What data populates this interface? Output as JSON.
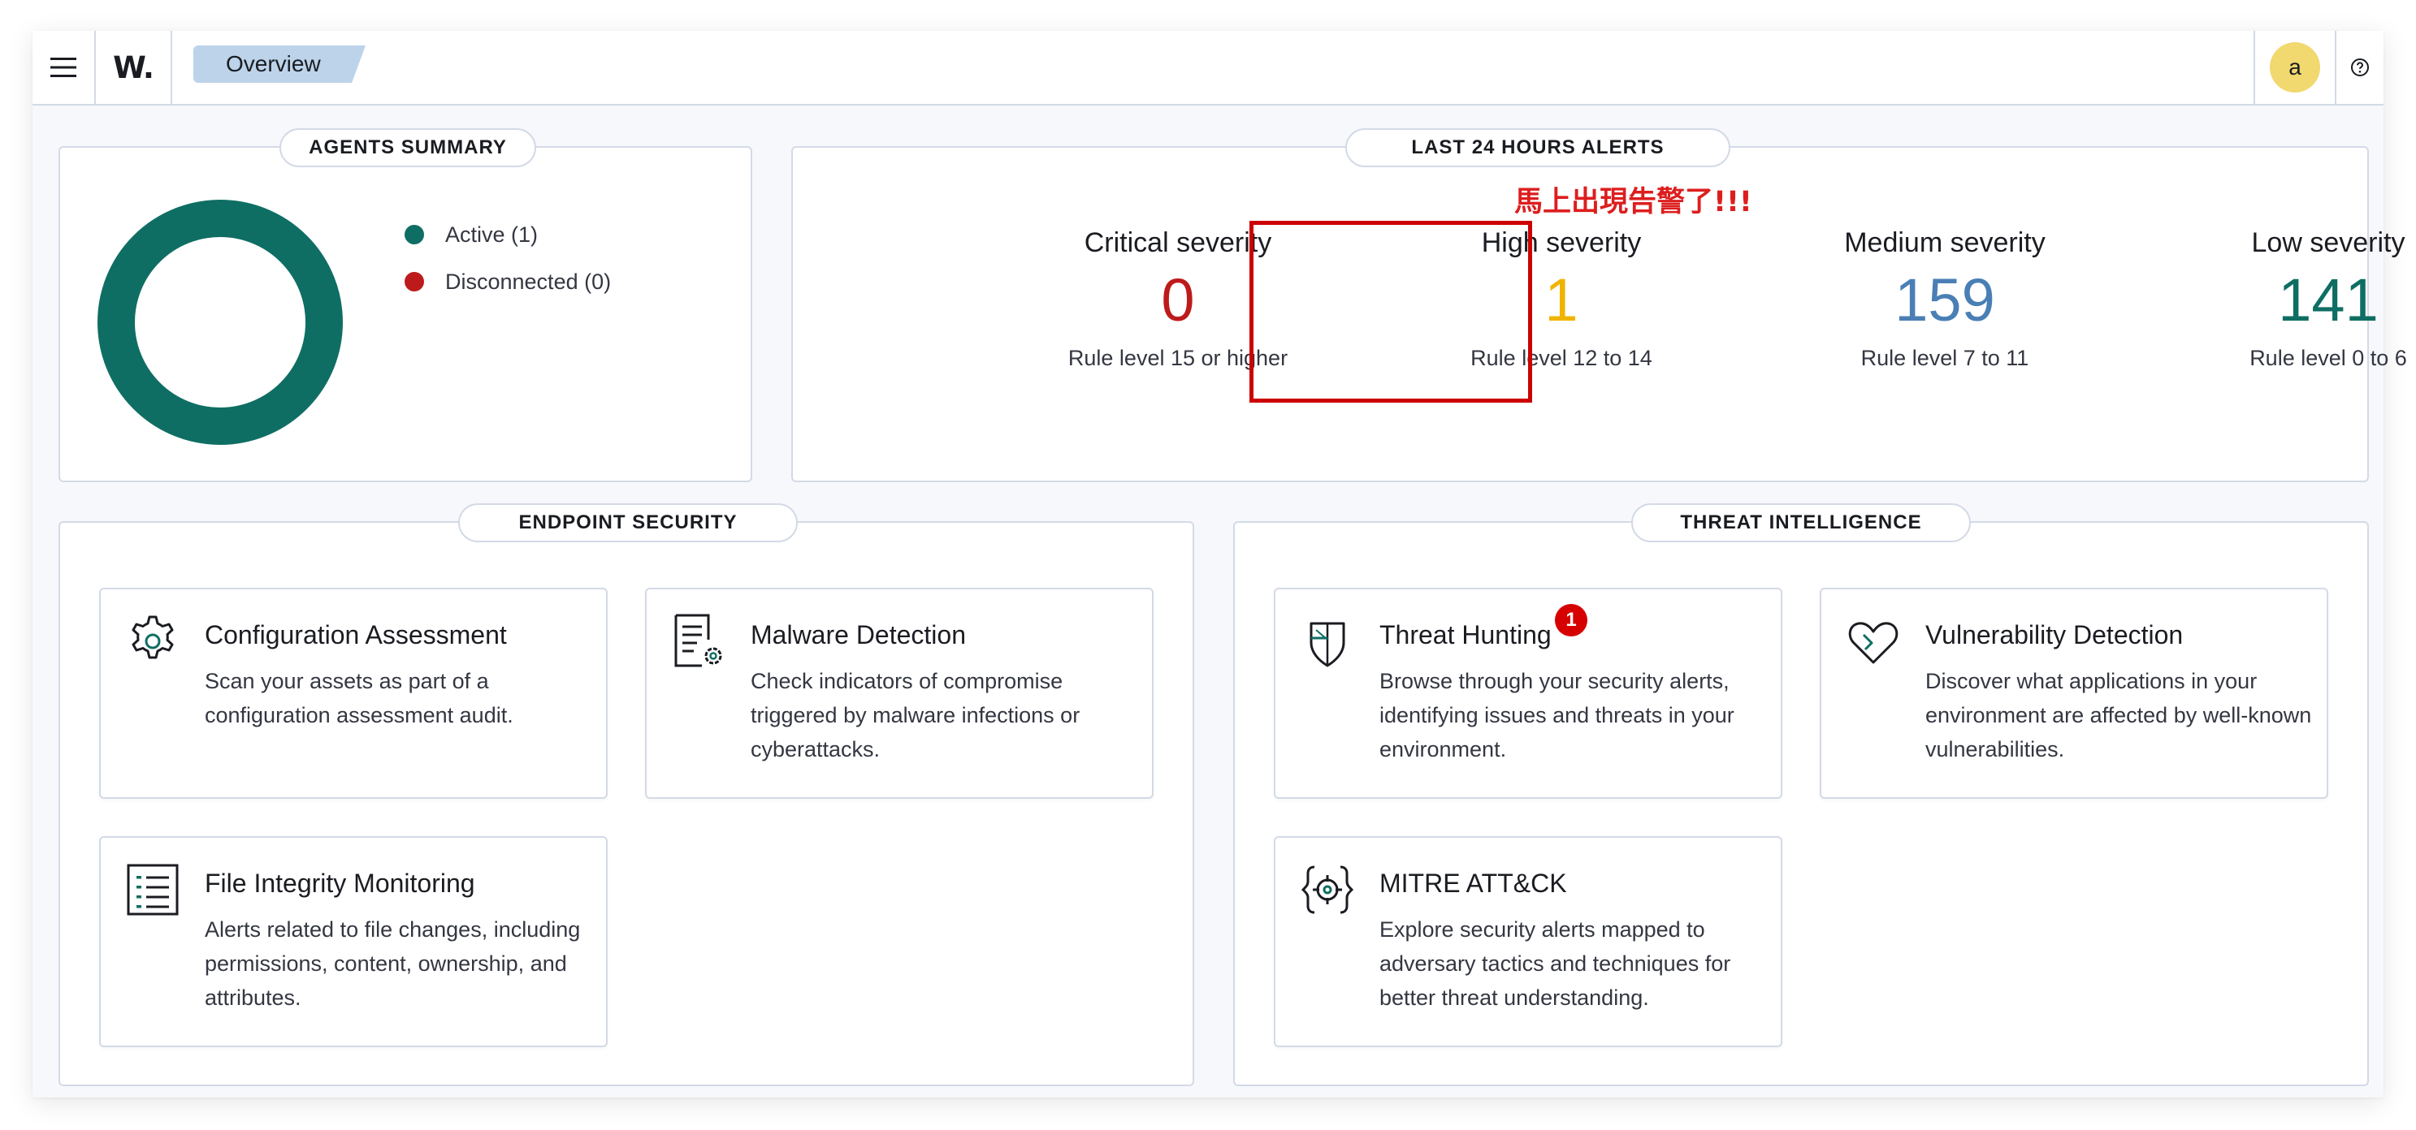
{
  "header": {
    "logo_text": "W.",
    "breadcrumb": "Overview",
    "avatar_initial": "a",
    "menu_icon": "hamburger-icon",
    "help_icon": "question-circle-icon"
  },
  "agents_summary": {
    "title": "AGENTS SUMMARY",
    "legend": [
      {
        "label": "Active (1)",
        "color": "#0f6e63"
      },
      {
        "label": "Disconnected (0)",
        "color": "#bd1b1b"
      }
    ],
    "donut": {
      "active": 1,
      "disconnected": 0,
      "color": "#0f6e63"
    }
  },
  "alerts": {
    "title": "LAST 24 HOURS ALERTS",
    "annotation": "馬上出現告警了!!!",
    "severities": [
      {
        "title": "Critical severity",
        "value": "0",
        "subtitle": "Rule level 15 or higher",
        "color": "#bd1b1b"
      },
      {
        "title": "High severity",
        "value": "1",
        "subtitle": "Rule level 12 to 14",
        "color": "#f0b400"
      },
      {
        "title": "Medium severity",
        "value": "159",
        "subtitle": "Rule level 7 to 11",
        "color": "#4a7fb5"
      },
      {
        "title": "Low severity",
        "value": "141",
        "subtitle": "Rule level 0 to 6",
        "color": "#0f6e63"
      }
    ]
  },
  "endpoint_security": {
    "title": "ENDPOINT SECURITY",
    "cards": [
      {
        "title": "Configuration Assessment",
        "description": "Scan your assets as part of a configuration assessment audit.",
        "icon": "gear-icon"
      },
      {
        "title": "Malware Detection",
        "description": "Check indicators of compromise triggered by malware infections or cyberattacks.",
        "icon": "document-gear-icon"
      },
      {
        "title": "File Integrity Monitoring",
        "description": "Alerts related to file changes, including permissions, content, ownership, and attributes.",
        "icon": "file-list-icon"
      }
    ]
  },
  "threat_intelligence": {
    "title": "THREAT INTELLIGENCE",
    "cards": [
      {
        "title": "Threat Hunting",
        "description": "Browse through your security alerts, identifying issues and threats in your environment.",
        "icon": "shield-icon",
        "badge": "1"
      },
      {
        "title": "Vulnerability Detection",
        "description": "Discover what applications in your environment are affected by well-known vulnerabilities.",
        "icon": "heart-icon"
      },
      {
        "title": "MITRE ATT&CK",
        "description": "Explore security alerts mapped to adversary tactics and techniques for better threat understanding.",
        "icon": "crosshair-icon"
      }
    ]
  }
}
